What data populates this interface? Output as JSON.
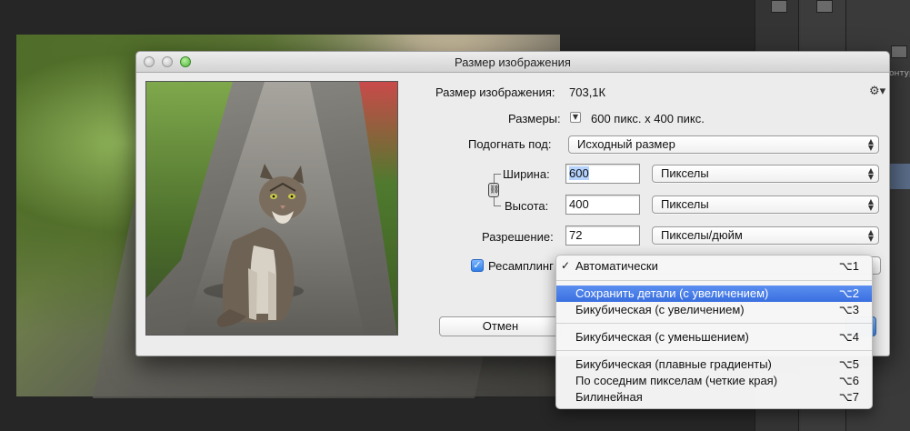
{
  "dialog": {
    "title": "Размер изображения",
    "image_size_label": "Размер изображения:",
    "image_size_value": "703,1К",
    "dimensions_label": "Размеры:",
    "dimensions_value": "600 пикс. x 400 пикс.",
    "fit_to_label": "Подогнать под:",
    "fit_to_value": "Исходный размер",
    "width_label": "Ширина:",
    "width_value": "600",
    "width_unit": "Пикселы",
    "height_label": "Высота:",
    "height_value": "400",
    "height_unit": "Пикселы",
    "resolution_label": "Разрешение:",
    "resolution_value": "72",
    "resolution_unit": "Пикселы/дюйм",
    "resample_label": "Ресамплинг",
    "resample_checked": true,
    "cancel_label": "Отмен"
  },
  "resample_menu": {
    "items": [
      {
        "label": "Автоматически",
        "shortcut": "⌥1",
        "checked": true,
        "active": false
      },
      {
        "label": "Сохранить детали (с увеличением)",
        "shortcut": "⌥2",
        "checked": false,
        "active": true
      },
      {
        "label": "Бикубическая (с увеличением)",
        "shortcut": "⌥3",
        "checked": false,
        "active": false
      },
      {
        "label": "Бикубическая (с уменьшением)",
        "shortcut": "⌥4",
        "checked": false,
        "active": false
      },
      {
        "label": "Бикубическая (плавные градиенты)",
        "shortcut": "⌥5",
        "checked": false,
        "active": false
      },
      {
        "label": "По соседним пикселам (четкие края)",
        "shortcut": "⌥6",
        "checked": false,
        "active": false
      },
      {
        "label": "Билинейная",
        "shortcut": "⌥7",
        "checked": false,
        "active": false
      }
    ]
  },
  "background": {
    "panel_tab_text": "онтуры"
  },
  "colors": {
    "menu_highlight": "#3a6fe0",
    "selection": "#b5d3ff",
    "dialog_bg": "#ececec"
  }
}
